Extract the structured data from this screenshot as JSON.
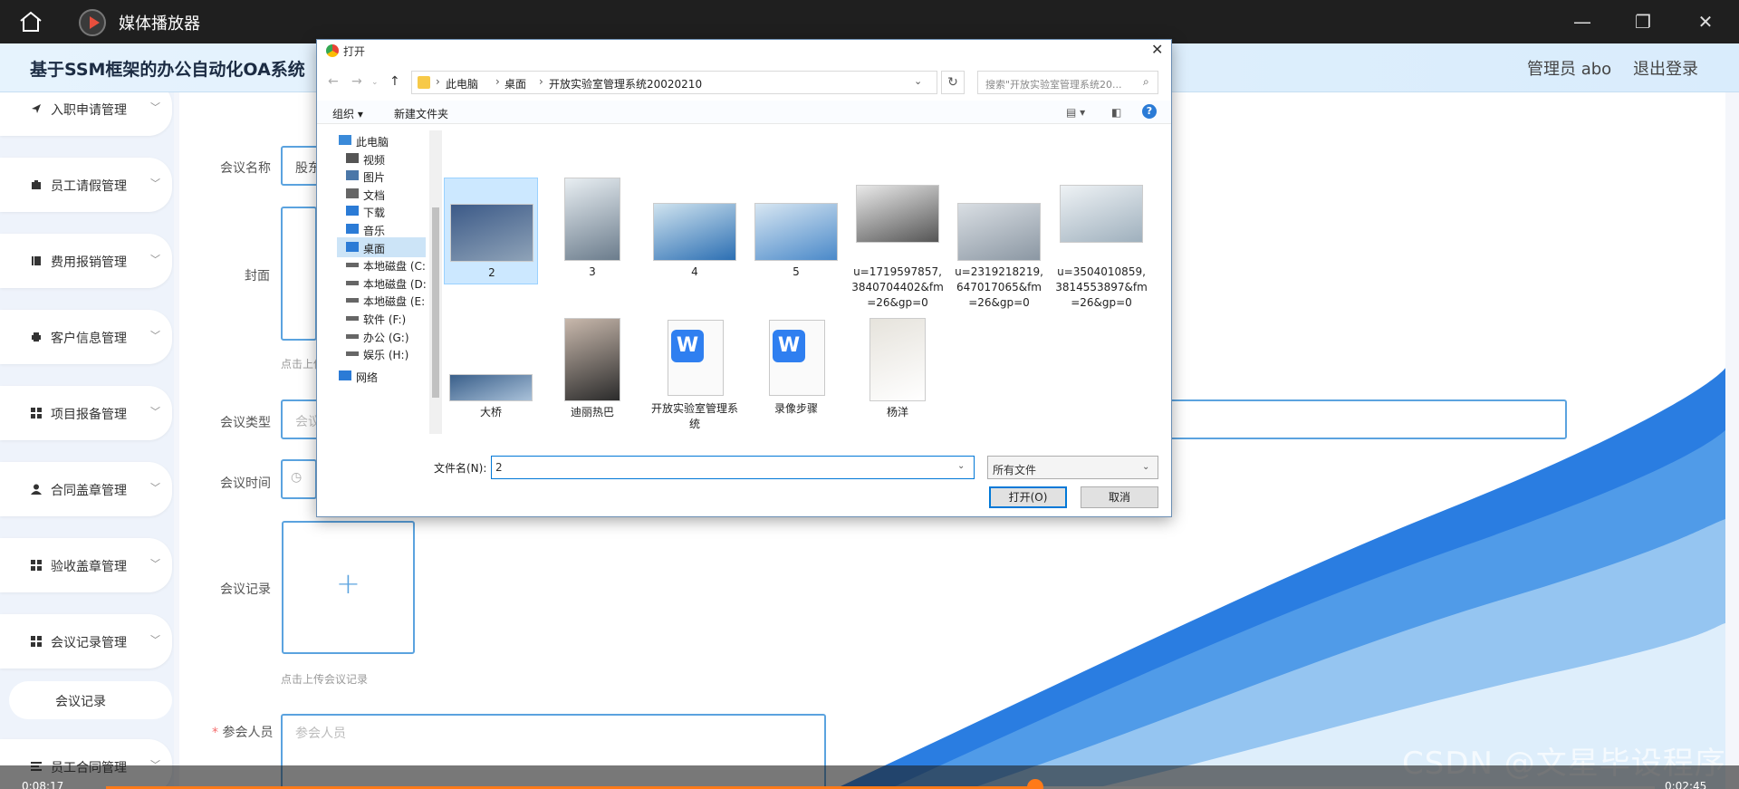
{
  "player": {
    "title": "媒体播放器",
    "time_elapsed": "0:08:17",
    "time_total": "0:02:45",
    "progress": 0.6
  },
  "app": {
    "title": "基于SSM框架的办公自动化OA系统",
    "user": "管理员 abo",
    "logout": "退出登录"
  },
  "sidebar": {
    "items": [
      {
        "label": "入职申请管理",
        "icon": "send-icon"
      },
      {
        "label": "员工请假管理",
        "icon": "briefcase-icon"
      },
      {
        "label": "费用报销管理",
        "icon": "book-icon"
      },
      {
        "label": "客户信息管理",
        "icon": "printer-icon"
      },
      {
        "label": "项目报备管理",
        "icon": "grid-icon"
      },
      {
        "label": "合同盖章管理",
        "icon": "user-icon"
      },
      {
        "label": "验收盖章管理",
        "icon": "grid-icon"
      },
      {
        "label": "会议记录管理",
        "icon": "grid-icon"
      }
    ],
    "subitem": "会议记录",
    "last_item": "员工合同管理"
  },
  "form": {
    "name_label": "会议名称",
    "name_value": "股东",
    "cover_label": "封面",
    "cover_hint": "点击上传",
    "type_label": "会议类型",
    "type_placeholder": "会议",
    "time_label": "会议时间",
    "record_label": "会议记录",
    "record_hint": "点击上传会议记录",
    "attendee_label": "参会人员",
    "attendee_placeholder": "参会人员",
    "required_mark": "*"
  },
  "dialog": {
    "title": "打开",
    "breadcrumb": [
      "此电脑",
      "桌面",
      "开放实验室管理系统20020210"
    ],
    "search_placeholder": "搜索\"开放实验室管理系统20...",
    "toolbar": {
      "organize": "组织 ▾",
      "new_folder": "新建文件夹",
      "help": "?"
    },
    "tree": [
      {
        "label": "此电脑",
        "icon": "computer-icon"
      },
      {
        "label": "视频",
        "icon": "video-icon"
      },
      {
        "label": "图片",
        "icon": "picture-icon"
      },
      {
        "label": "文档",
        "icon": "document-icon"
      },
      {
        "label": "下载",
        "icon": "download-icon"
      },
      {
        "label": "音乐",
        "icon": "music-icon"
      },
      {
        "label": "桌面",
        "icon": "desktop-icon",
        "selected": true
      },
      {
        "label": "本地磁盘 (C:",
        "icon": "drive-icon"
      },
      {
        "label": "本地磁盘 (D:",
        "icon": "drive-icon"
      },
      {
        "label": "本地磁盘 (E:",
        "icon": "drive-icon"
      },
      {
        "label": "软件 (F:)",
        "icon": "drive-icon"
      },
      {
        "label": "办公 (G:)",
        "icon": "drive-icon"
      },
      {
        "label": "娱乐 (H:)",
        "icon": "drive-icon"
      },
      {
        "label": "网络",
        "icon": "network-icon"
      }
    ],
    "files": [
      {
        "name": "2",
        "kind": "photo",
        "colors": [
          "#3c5a88",
          "#8fa3b8"
        ],
        "selected": true
      },
      {
        "name": "3",
        "kind": "photo",
        "colors": [
          "#e8eef2",
          "#6b7c8c"
        ]
      },
      {
        "name": "4",
        "kind": "photo",
        "colors": [
          "#cfe3ef",
          "#2c6fb3"
        ]
      },
      {
        "name": "5",
        "kind": "photo",
        "colors": [
          "#d7e6f2",
          "#4a89c9"
        ]
      },
      {
        "name": "u=1719597857,3840704402&fm=26&gp=0",
        "kind": "photo",
        "colors": [
          "#e9e9e9",
          "#555555"
        ]
      },
      {
        "name": "u=2319218219,647017065&fm=26&gp=0",
        "kind": "photo",
        "colors": [
          "#d9dee3",
          "#8b97a3"
        ]
      },
      {
        "name": "u=3504010859,3814553897&fm=26&gp=0",
        "kind": "photo",
        "colors": [
          "#eef2f5",
          "#9fb0bd"
        ]
      },
      {
        "name": "大桥",
        "kind": "photo",
        "colors": [
          "#3a5f8a",
          "#a9c1d9"
        ]
      },
      {
        "name": "迪丽热巴",
        "kind": "photo",
        "colors": [
          "#c8b8ac",
          "#2b2b2b"
        ]
      },
      {
        "name": "开放实验室管理系统",
        "kind": "doc"
      },
      {
        "name": "录像步骤",
        "kind": "doc"
      },
      {
        "name": "杨洋",
        "kind": "photo",
        "colors": [
          "#e6e3dc",
          "#ffffff"
        ]
      }
    ],
    "filename_label": "文件名(N):",
    "filename_value": "2",
    "filetype": "所有文件",
    "open_button": "打开(O)",
    "cancel_button": "取消"
  },
  "watermark": "CSDN @文星毕设程序",
  "colors": {
    "accent": "#5ba3df",
    "player_orange": "#ff7a18",
    "selection": "#cce8ff"
  }
}
